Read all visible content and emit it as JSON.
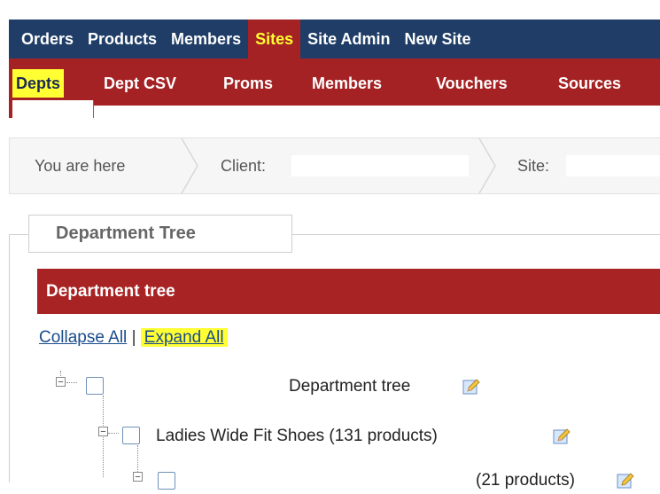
{
  "top_nav": {
    "items": [
      "Orders",
      "Products",
      "Members",
      "Sites",
      "Site Admin",
      "New Site"
    ],
    "active": "Sites"
  },
  "sub_nav": {
    "items": [
      "Depts",
      "Dept CSV",
      "Proms",
      "Members",
      "Vouchers",
      "Sources"
    ],
    "active": "Depts"
  },
  "breadcrumb": {
    "you_are_here": "You are here",
    "client_label": "Client:",
    "site_label": "Site:"
  },
  "section": {
    "legend": "Department Tree",
    "header": "Department tree"
  },
  "tree_links": {
    "collapse_all": "Collapse All",
    "separator": "|",
    "expand_all": "Expand All"
  },
  "tree": {
    "root_suffix": "Department tree",
    "child_label": "Ladies Wide Fit Shoes",
    "child_count": "(131 products)",
    "third_count": "(21 products)"
  },
  "icons": {
    "toggle": "tree-toggle-icon",
    "edit": "edit-pencil-icon",
    "chevron": "breadcrumb-chevron-icon"
  },
  "colors": {
    "top_nav_bg": "#1f3d66",
    "sub_nav_bg": "#a52224",
    "highlight": "#ffff33",
    "tree_header_bg": "#a82323",
    "link": "#1a4c8c"
  }
}
